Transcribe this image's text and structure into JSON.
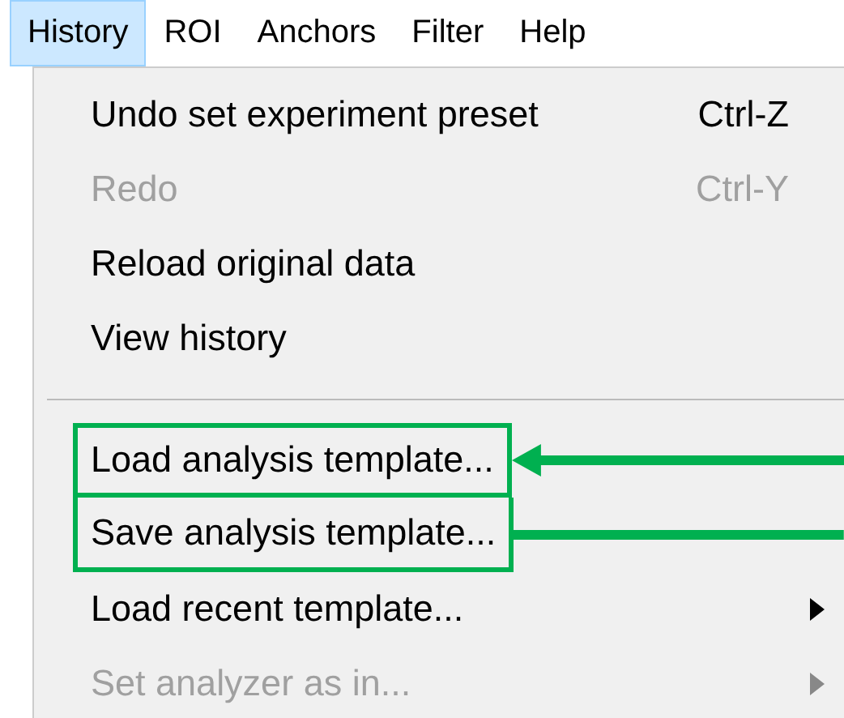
{
  "menu_bar": [
    {
      "label": "History",
      "selected": true
    },
    {
      "label": "ROI",
      "selected": false
    },
    {
      "label": "Anchors",
      "selected": false
    },
    {
      "label": "Filter",
      "selected": false
    },
    {
      "label": "Help",
      "selected": false
    }
  ],
  "menu": {
    "groups": [
      [
        {
          "label": "Undo set experiment preset",
          "shortcut": "Ctrl-Z",
          "disabled": false,
          "kind": "command"
        },
        {
          "label": "Redo",
          "shortcut": "Ctrl-Y",
          "disabled": true,
          "kind": "command"
        },
        {
          "label": "Reload original data",
          "disabled": false,
          "kind": "command"
        },
        {
          "label": "View history",
          "disabled": false,
          "kind": "command"
        }
      ],
      [
        {
          "label": "Load analysis template...",
          "disabled": false,
          "kind": "command",
          "highlighted": true,
          "pointer": {
            "kind": "arrow"
          }
        },
        {
          "label": "Save analysis template...",
          "disabled": false,
          "kind": "command",
          "highlighted": true,
          "pointer": {
            "kind": "line"
          }
        },
        {
          "label": "Load recent template...",
          "disabled": false,
          "kind": "submenu"
        },
        {
          "label": "Set analyzer as in...",
          "disabled": true,
          "kind": "submenu"
        }
      ]
    ]
  }
}
